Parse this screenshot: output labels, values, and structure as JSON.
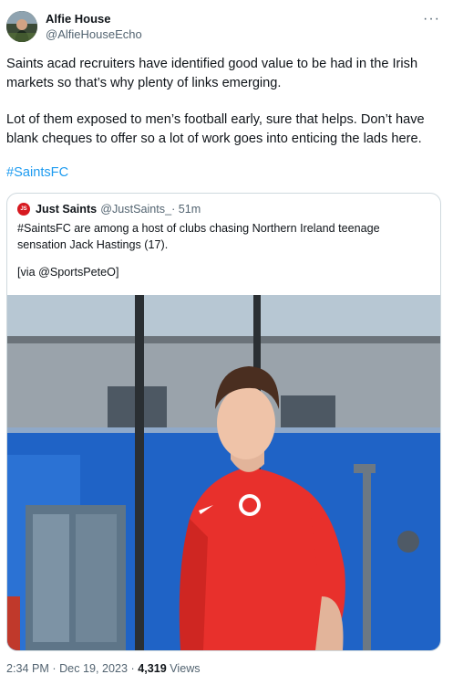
{
  "author": {
    "name": "Alfie House",
    "handle": "@AlfieHouseEcho"
  },
  "more_menu": "···",
  "text": {
    "p1": "Saints acad recruiters have identified good value to be had in the Irish markets so that’s why plenty of links emerging.",
    "p2": "Lot of them exposed to men’s football early, sure that helps. Don’t have blank cheques to offer so a lot of work goes into enticing the lads here.",
    "hashtag": "#SaintsFC"
  },
  "quote": {
    "logo_text": "JS",
    "name": "Just Saints",
    "handle": "@JustSaints_",
    "time": "· 51m",
    "text": "#SaintsFC are among a host of clubs chasing Northern Ireland teenage sensation Jack Hastings (17).",
    "via": "[via @SportsPeteO]",
    "photo_icon": "player-photo"
  },
  "meta": {
    "timestamp": "2:34 PM · Dec 19, 2023 · ",
    "views_count": "4,319",
    "views_label": " Views"
  },
  "colors": {
    "link": "#1d9bf0",
    "secondary_text": "#536471",
    "shirt_red": "#e8302c",
    "building_blue": "#1f63c6"
  }
}
